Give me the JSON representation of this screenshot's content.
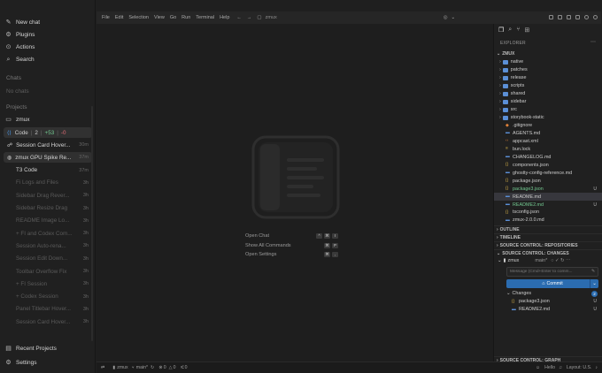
{
  "sidebar": {
    "nav": [
      {
        "label": "New chat",
        "icon": "pencil-icon"
      },
      {
        "label": "Plugins",
        "icon": "plugin-icon"
      },
      {
        "label": "Actions",
        "icon": "actions-icon"
      },
      {
        "label": "Search",
        "icon": "search-icon"
      }
    ],
    "chats_label": "Chats",
    "no_chats": "No chats",
    "projects_label": "Projects",
    "project_name": "zmux",
    "code_row": {
      "label": "Code",
      "branch": "2",
      "added": "+53",
      "removed": "-0"
    },
    "chats": [
      {
        "title": "Session Card Hover...",
        "time": "30m"
      },
      {
        "title": "zmux GPU Spike Re...",
        "time": "37m"
      },
      {
        "title": "T3 Code",
        "time": "37m"
      },
      {
        "title": "Fi Logs and Files",
        "time": "3h"
      },
      {
        "title": "Sidebar Drag Rever...",
        "time": "3h"
      },
      {
        "title": "Sidebar Resize Drag",
        "time": "3h"
      },
      {
        "title": "README Image Lo...",
        "time": "3h"
      },
      {
        "title": "+ FI and Codex Com...",
        "time": "3h"
      },
      {
        "title": "Session Auto-rena...",
        "time": "3h"
      },
      {
        "title": "Session Edit Down...",
        "time": "3h"
      },
      {
        "title": "Toolbar Overflow Fix",
        "time": "3h"
      },
      {
        "title": "+ FI Session",
        "time": "3h"
      },
      {
        "title": "+ Codex Session",
        "time": "3h"
      },
      {
        "title": "Panel Titlebar Hover...",
        "time": "3h"
      },
      {
        "title": "Session Card Hover...",
        "time": "3h"
      }
    ],
    "recent_projects": "Recent Projects",
    "settings": "Settings"
  },
  "menubar": {
    "items": [
      "File",
      "Edit",
      "Selection",
      "View",
      "Go",
      "Run",
      "Terminal",
      "Help"
    ],
    "search": "zmux"
  },
  "welcome": {
    "shortcuts": [
      {
        "label": "Open Chat",
        "keys": [
          "^",
          "⌘",
          "I"
        ]
      },
      {
        "label": "Show All Commands",
        "keys": [
          "⌘",
          "P"
        ]
      },
      {
        "label": "Open Settings",
        "keys": [
          "⌘",
          ","
        ]
      }
    ]
  },
  "explorer": {
    "title": "EXPLORER",
    "root": "ZMUX",
    "folders": [
      "native",
      "patches",
      "release",
      "scripts",
      "shared",
      "sidebar",
      "src",
      "storybook-static"
    ],
    "files": [
      {
        "name": ".gitignore",
        "kind": "git",
        "status": ""
      },
      {
        "name": "AGENTS.md",
        "kind": "md",
        "status": ""
      },
      {
        "name": "appcast.xml",
        "kind": "xml",
        "status": ""
      },
      {
        "name": "bun.lock",
        "kind": "lock",
        "status": ""
      },
      {
        "name": "CHANGELOG.md",
        "kind": "md",
        "status": ""
      },
      {
        "name": "components.json",
        "kind": "json",
        "status": ""
      },
      {
        "name": "ghostty-config-reference.md",
        "kind": "md",
        "status": ""
      },
      {
        "name": "package.json",
        "kind": "json",
        "status": ""
      },
      {
        "name": "package3.json",
        "kind": "json",
        "status": "U"
      },
      {
        "name": "README.md",
        "kind": "md",
        "status": ""
      },
      {
        "name": "README2.md",
        "kind": "md",
        "status": "U"
      },
      {
        "name": "tsconfig.json",
        "kind": "json",
        "status": ""
      },
      {
        "name": "zmux-2.0.0.md",
        "kind": "md",
        "status": ""
      }
    ],
    "sections": [
      "OUTLINE",
      "TIMELINE",
      "SOURCE CONTROL: REPOSITORIES",
      "SOURCE CONTROL: CHANGES"
    ],
    "scm": {
      "repo": "zmux",
      "branch": "main*",
      "placeholder": "Message (Cmd+Enter to comm...",
      "commit": "Commit",
      "changes_label": "Changes",
      "changes_count": "2",
      "changes": [
        {
          "name": "package3.json",
          "status": "U"
        },
        {
          "name": "README2.md",
          "status": "U"
        }
      ]
    },
    "graph": "SOURCE CONTROL: GRAPH"
  },
  "statusbar": {
    "repo": "zmux",
    "branch": "main*",
    "errors": "0",
    "warnings": "0",
    "ports": "0",
    "hello": "Hello",
    "layout": "Layout: U.S."
  },
  "colors": {
    "accent": "#2b6cb0",
    "folder": "#5b8fd6",
    "json": "#d9b44a",
    "md": "#5b8fd6",
    "untracked": "#73c991"
  }
}
